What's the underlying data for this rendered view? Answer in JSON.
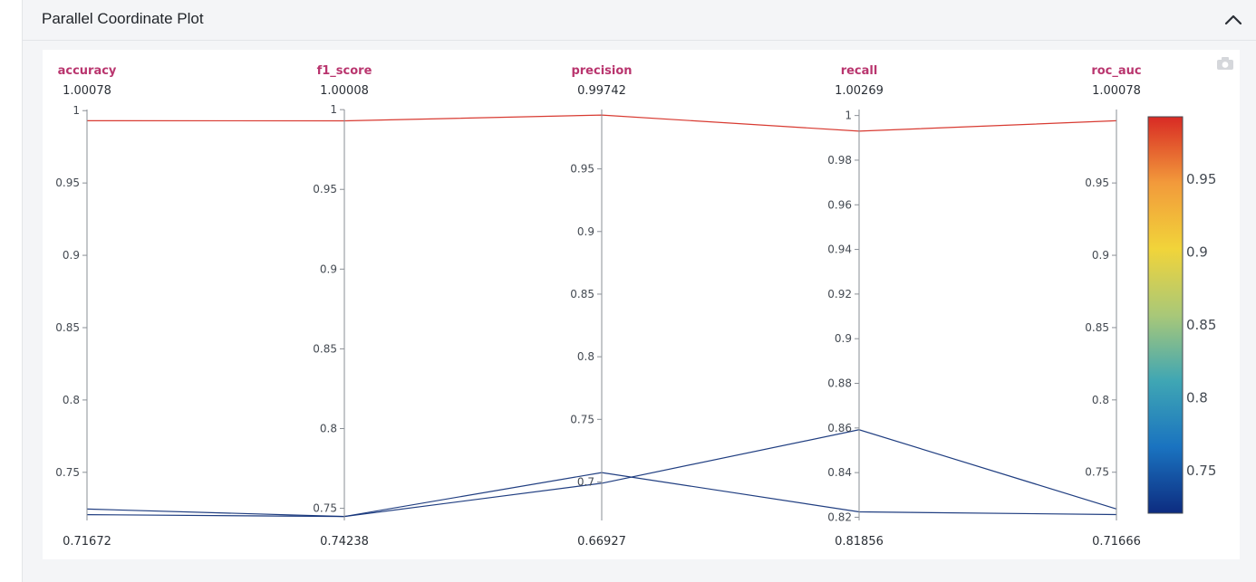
{
  "panel": {
    "title": "Parallel Coordinate Plot",
    "collapse_icon": "chevron-up-icon",
    "modebar_icon": "camera-icon"
  },
  "chart_data": {
    "type": "parallel_coordinates",
    "dimensions": [
      {
        "name": "accuracy",
        "range_max_label": "1.00078",
        "range_min_label": "0.71672",
        "range": [
          0.71672,
          1.00078
        ],
        "ticks": [
          {
            "v": 1,
            "label": "1"
          },
          {
            "v": 0.95,
            "label": "0.95"
          },
          {
            "v": 0.9,
            "label": "0.9"
          },
          {
            "v": 0.85,
            "label": "0.85"
          },
          {
            "v": 0.8,
            "label": "0.8"
          },
          {
            "v": 0.75,
            "label": "0.75"
          }
        ]
      },
      {
        "name": "f1_score",
        "range_max_label": "1.00008",
        "range_min_label": "0.74238",
        "range": [
          0.74238,
          1.00008
        ],
        "ticks": [
          {
            "v": 1,
            "label": "1"
          },
          {
            "v": 0.95,
            "label": "0.95"
          },
          {
            "v": 0.9,
            "label": "0.9"
          },
          {
            "v": 0.85,
            "label": "0.85"
          },
          {
            "v": 0.8,
            "label": "0.8"
          },
          {
            "v": 0.75,
            "label": "0.75"
          }
        ]
      },
      {
        "name": "precision",
        "range_max_label": "0.99742",
        "range_min_label": "0.66927",
        "range": [
          0.66927,
          0.99742
        ],
        "ticks": [
          {
            "v": 0.95,
            "label": "0.95"
          },
          {
            "v": 0.9,
            "label": "0.9"
          },
          {
            "v": 0.85,
            "label": "0.85"
          },
          {
            "v": 0.8,
            "label": "0.8"
          },
          {
            "v": 0.75,
            "label": "0.75"
          },
          {
            "v": 0.7,
            "label": "0.7"
          }
        ]
      },
      {
        "name": "recall",
        "range_max_label": "1.00269",
        "range_min_label": "0.81856",
        "range": [
          0.81856,
          1.00269
        ],
        "ticks": [
          {
            "v": 1,
            "label": "1"
          },
          {
            "v": 0.98,
            "label": "0.98"
          },
          {
            "v": 0.96,
            "label": "0.96"
          },
          {
            "v": 0.94,
            "label": "0.94"
          },
          {
            "v": 0.92,
            "label": "0.92"
          },
          {
            "v": 0.9,
            "label": "0.9"
          },
          {
            "v": 0.88,
            "label": "0.88"
          },
          {
            "v": 0.86,
            "label": "0.86"
          },
          {
            "v": 0.84,
            "label": "0.84"
          },
          {
            "v": 0.82,
            "label": "0.82"
          }
        ]
      },
      {
        "name": "roc_auc",
        "range_max_label": "1.00078",
        "range_min_label": "0.71666",
        "range": [
          0.71666,
          1.00078
        ],
        "ticks": [
          {
            "v": 0.95,
            "label": "0.95"
          },
          {
            "v": 0.9,
            "label": "0.9"
          },
          {
            "v": 0.85,
            "label": "0.85"
          },
          {
            "v": 0.8,
            "label": "0.8"
          },
          {
            "v": 0.75,
            "label": "0.75"
          }
        ]
      }
    ],
    "lines": [
      {
        "values": [
          0.993,
          0.993,
          0.993,
          0.993,
          0.993
        ],
        "color": "#d62f26"
      },
      {
        "values": [
          0.7246,
          0.7449,
          0.699,
          0.8592,
          0.7246
        ],
        "color": "#14347a"
      },
      {
        "values": [
          0.7207,
          0.7449,
          0.7075,
          0.8224,
          0.7207
        ],
        "color": "#14347a"
      }
    ],
    "colorscale": {
      "ticks": [
        {
          "v": 0.95,
          "label": "0.95"
        },
        {
          "v": 0.9,
          "label": "0.9"
        },
        {
          "v": 0.85,
          "label": "0.85"
        },
        {
          "v": 0.8,
          "label": "0.8"
        },
        {
          "v": 0.75,
          "label": "0.75"
        }
      ],
      "range": [
        0.7207,
        0.993
      ],
      "stops": [
        "#0d2c80",
        "#1a73c0",
        "#3fa6b4",
        "#a9c878",
        "#f1d43a",
        "#f29a3b",
        "#d82a24"
      ]
    }
  }
}
